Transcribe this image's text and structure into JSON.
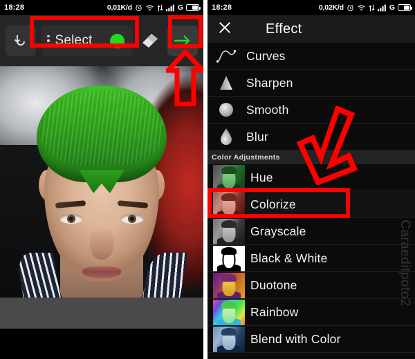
{
  "left": {
    "statusbar": {
      "time": "18:28",
      "data_rate": "0,01K/d",
      "alarm_icon": "alarm-clock-icon",
      "wifi_icon": "wifi-icon",
      "data_transfer_icon": "data-transfer-icon",
      "signal_icon": "signal-bars-icon",
      "network_type": "G",
      "battery_icon": "battery-icon"
    },
    "toolbar": {
      "undo_icon": "undo-icon",
      "menu_icon": "kebab-menu-icon",
      "select_label": "Select",
      "color_swatch": "#22d91f",
      "eraser_icon": "eraser-icon",
      "apply_icon": "arrow-right-icon",
      "apply_color": "#22d91f"
    },
    "canvas": {
      "description": "portrait-photo-with-green-hair"
    }
  },
  "right": {
    "statusbar": {
      "time": "18:28",
      "data_rate": "0,02K/d",
      "alarm_icon": "alarm-clock-icon",
      "wifi_icon": "wifi-icon",
      "data_transfer_icon": "data-transfer-icon",
      "signal_icon": "signal-bars-icon",
      "network_type": "G",
      "battery_icon": "battery-icon"
    },
    "header": {
      "close_icon": "close-x-icon",
      "title": "Effect"
    },
    "effects": [
      {
        "label": "Curves",
        "icon": "curves-icon"
      },
      {
        "label": "Sharpen",
        "icon": "sharpen-triangle-icon"
      },
      {
        "label": "Smooth",
        "icon": "smooth-sphere-icon"
      },
      {
        "label": "Blur",
        "icon": "blur-droplet-icon"
      }
    ],
    "section_title": "Color Adjustments",
    "color_adjustments": [
      {
        "label": "Hue",
        "icon": "thumbnail-hue"
      },
      {
        "label": "Colorize",
        "icon": "thumbnail-colorize"
      },
      {
        "label": "Grayscale",
        "icon": "thumbnail-grayscale"
      },
      {
        "label": "Black & White",
        "icon": "thumbnail-black-and-white"
      },
      {
        "label": "Duotone",
        "icon": "thumbnail-duotone"
      },
      {
        "label": "Rainbow",
        "icon": "thumbnail-rainbow"
      },
      {
        "label": "Blend with Color",
        "icon": "thumbnail-blend-with-color"
      }
    ],
    "watermark": "Caraeditpoto2"
  },
  "annotations": {
    "color": "#fe0000",
    "highlight_select": "Select",
    "highlight_apply": "arrow-right-icon",
    "highlight_colorize": "Colorize",
    "up_arrow": "up-arrow-annotation",
    "down_arrow": "down-arrow-annotation"
  }
}
